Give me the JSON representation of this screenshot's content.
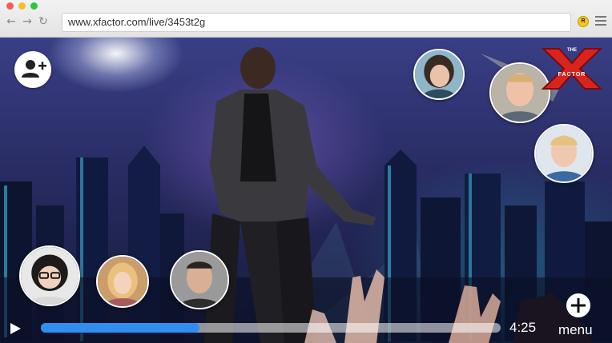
{
  "browser": {
    "url": "www.xfactor.com/live/3453t2g",
    "back_icon": "←",
    "forward_icon": "→",
    "reload_icon": "↻",
    "extension_badge": "R"
  },
  "player": {
    "logo_text_top": "THE",
    "logo_text_bottom": "FACTOR",
    "time_remaining": "4:25",
    "progress_fraction": 0.345,
    "menu_label": "menu",
    "accent_color": "#2f8ef0"
  },
  "icons": [
    "add-friend-icon",
    "play-icon",
    "plus-icon",
    "menu-icon"
  ]
}
